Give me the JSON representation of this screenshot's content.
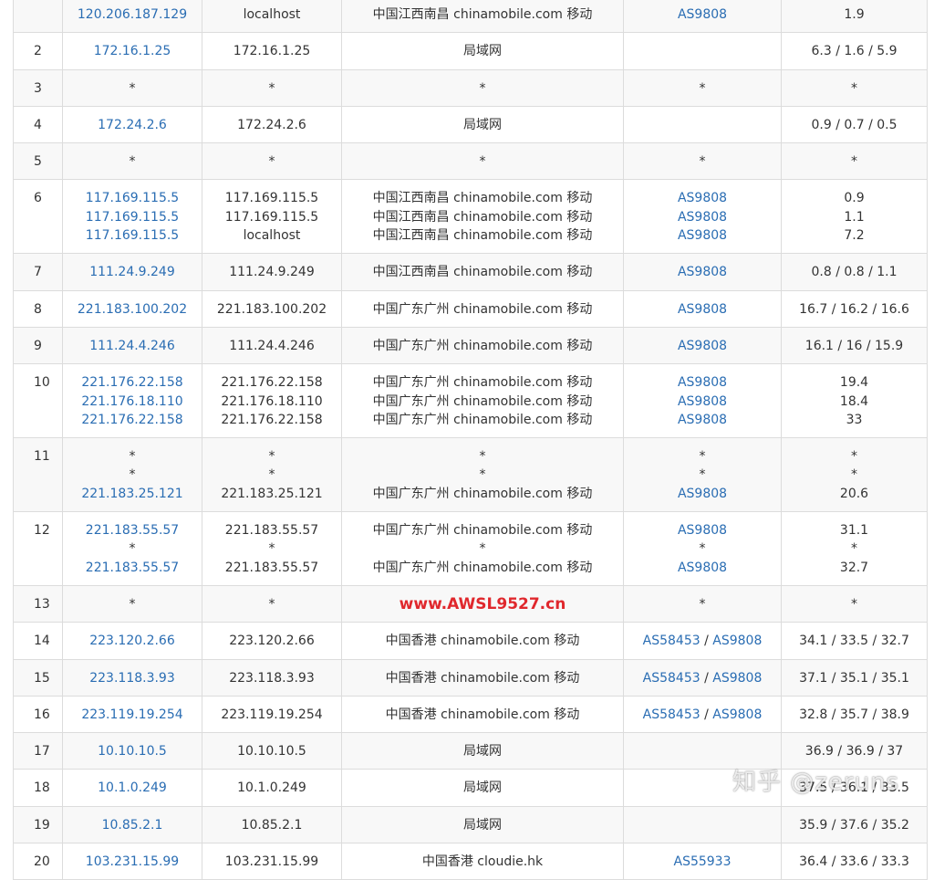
{
  "hops": [
    {
      "hop": "",
      "lines": [
        {
          "ip": "120.206.187.129",
          "host": "localhost",
          "loc": "中国江西南昌 chinamobile.com 移动",
          "asn": [
            "AS9808"
          ],
          "time": "1.9"
        }
      ]
    },
    {
      "hop": "2",
      "lines": [
        {
          "ip": "172.16.1.25",
          "host": "172.16.1.25",
          "loc": "局域网",
          "asn": [],
          "time": "6.3 / 1.6 / 5.9"
        }
      ]
    },
    {
      "hop": "3",
      "lines": [
        {
          "ip": "*",
          "host": "*",
          "loc": "*",
          "asn": [
            "*"
          ],
          "time": "*"
        }
      ]
    },
    {
      "hop": "4",
      "lines": [
        {
          "ip": "172.24.2.6",
          "host": "172.24.2.6",
          "loc": "局域网",
          "asn": [],
          "time": "0.9 / 0.7 / 0.5"
        }
      ]
    },
    {
      "hop": "5",
      "lines": [
        {
          "ip": "*",
          "host": "*",
          "loc": "*",
          "asn": [
            "*"
          ],
          "time": "*"
        }
      ]
    },
    {
      "hop": "6",
      "lines": [
        {
          "ip": "117.169.115.5",
          "host": "117.169.115.5",
          "loc": "中国江西南昌 chinamobile.com 移动",
          "asn": [
            "AS9808"
          ],
          "time": "0.9"
        },
        {
          "ip": "117.169.115.5",
          "host": "117.169.115.5",
          "loc": "中国江西南昌 chinamobile.com 移动",
          "asn": [
            "AS9808"
          ],
          "time": "1.1"
        },
        {
          "ip": "117.169.115.5",
          "host": "localhost",
          "loc": "中国江西南昌 chinamobile.com 移动",
          "asn": [
            "AS9808"
          ],
          "time": "7.2"
        }
      ]
    },
    {
      "hop": "7",
      "lines": [
        {
          "ip": "111.24.9.249",
          "host": "111.24.9.249",
          "loc": "中国江西南昌 chinamobile.com 移动",
          "asn": [
            "AS9808"
          ],
          "time": "0.8 / 0.8 / 1.1"
        }
      ]
    },
    {
      "hop": "8",
      "lines": [
        {
          "ip": "221.183.100.202",
          "host": "221.183.100.202",
          "loc": "中国广东广州 chinamobile.com 移动",
          "asn": [
            "AS9808"
          ],
          "time": "16.7 / 16.2 / 16.6"
        }
      ]
    },
    {
      "hop": "9",
      "lines": [
        {
          "ip": "111.24.4.246",
          "host": "111.24.4.246",
          "loc": "中国广东广州 chinamobile.com 移动",
          "asn": [
            "AS9808"
          ],
          "time": "16.1 / 16 / 15.9"
        }
      ]
    },
    {
      "hop": "10",
      "lines": [
        {
          "ip": "221.176.22.158",
          "host": "221.176.22.158",
          "loc": "中国广东广州 chinamobile.com 移动",
          "asn": [
            "AS9808"
          ],
          "time": "19.4"
        },
        {
          "ip": "221.176.18.110",
          "host": "221.176.18.110",
          "loc": "中国广东广州 chinamobile.com 移动",
          "asn": [
            "AS9808"
          ],
          "time": "18.4"
        },
        {
          "ip": "221.176.22.158",
          "host": "221.176.22.158",
          "loc": "中国广东广州 chinamobile.com 移动",
          "asn": [
            "AS9808"
          ],
          "time": "33"
        }
      ]
    },
    {
      "hop": "11",
      "lines": [
        {
          "ip": "*",
          "host": "*",
          "loc": "*",
          "asn": [
            "*"
          ],
          "time": "*"
        },
        {
          "ip": "*",
          "host": "*",
          "loc": "*",
          "asn": [
            "*"
          ],
          "time": "*"
        },
        {
          "ip": "221.183.25.121",
          "host": "221.183.25.121",
          "loc": "中国广东广州 chinamobile.com 移动",
          "asn": [
            "AS9808"
          ],
          "time": "20.6"
        }
      ]
    },
    {
      "hop": "12",
      "lines": [
        {
          "ip": "221.183.55.57",
          "host": "221.183.55.57",
          "loc": "中国广东广州 chinamobile.com 移动",
          "asn": [
            "AS9808"
          ],
          "time": "31.1"
        },
        {
          "ip": "*",
          "host": "*",
          "loc": "*",
          "asn": [
            "*"
          ],
          "time": "*"
        },
        {
          "ip": "221.183.55.57",
          "host": "221.183.55.57",
          "loc": "中国广东广州 chinamobile.com 移动",
          "asn": [
            "AS9808"
          ],
          "time": "32.7"
        }
      ]
    },
    {
      "hop": "13",
      "lines": [
        {
          "ip": "*",
          "host": "*",
          "loc": "www.AWSL9527.cn",
          "asn": [
            "*"
          ],
          "time": "*",
          "loc_is_watermark": true
        }
      ]
    },
    {
      "hop": "14",
      "lines": [
        {
          "ip": "223.120.2.66",
          "host": "223.120.2.66",
          "loc": "中国香港 chinamobile.com 移动",
          "asn": [
            "AS58453",
            "AS9808"
          ],
          "time": "34.1 / 33.5 / 32.7"
        }
      ]
    },
    {
      "hop": "15",
      "lines": [
        {
          "ip": "223.118.3.93",
          "host": "223.118.3.93",
          "loc": "中国香港 chinamobile.com 移动",
          "asn": [
            "AS58453",
            "AS9808"
          ],
          "time": "37.1 / 35.1 / 35.1"
        }
      ]
    },
    {
      "hop": "16",
      "lines": [
        {
          "ip": "223.119.19.254",
          "host": "223.119.19.254",
          "loc": "中国香港 chinamobile.com 移动",
          "asn": [
            "AS58453",
            "AS9808"
          ],
          "time": "32.8 / 35.7 / 38.9"
        }
      ]
    },
    {
      "hop": "17",
      "lines": [
        {
          "ip": "10.10.10.5",
          "host": "10.10.10.5",
          "loc": "局域网",
          "asn": [],
          "time": "36.9 / 36.9 / 37"
        }
      ]
    },
    {
      "hop": "18",
      "lines": [
        {
          "ip": "10.1.0.249",
          "host": "10.1.0.249",
          "loc": "局域网",
          "asn": [],
          "time": "37.5 / 36.1 / 33.5"
        }
      ]
    },
    {
      "hop": "19",
      "lines": [
        {
          "ip": "10.85.2.1",
          "host": "10.85.2.1",
          "loc": "局域网",
          "asn": [],
          "time": "35.9 / 37.6 / 35.2"
        }
      ]
    },
    {
      "hop": "20",
      "lines": [
        {
          "ip": "103.231.15.99",
          "host": "103.231.15.99",
          "loc": "中国香港 cloudie.hk",
          "asn": [
            "AS55933"
          ],
          "time": "36.4 / 33.6 / 33.3"
        }
      ]
    }
  ],
  "asn_separator": " / ",
  "watermark": {
    "text": "知乎 @zeruns"
  },
  "colors": {
    "link": "#2a6db3",
    "watermark_url": "#e0282d",
    "row_stripe": "#f8f8f8",
    "border": "#dcdcdc"
  }
}
